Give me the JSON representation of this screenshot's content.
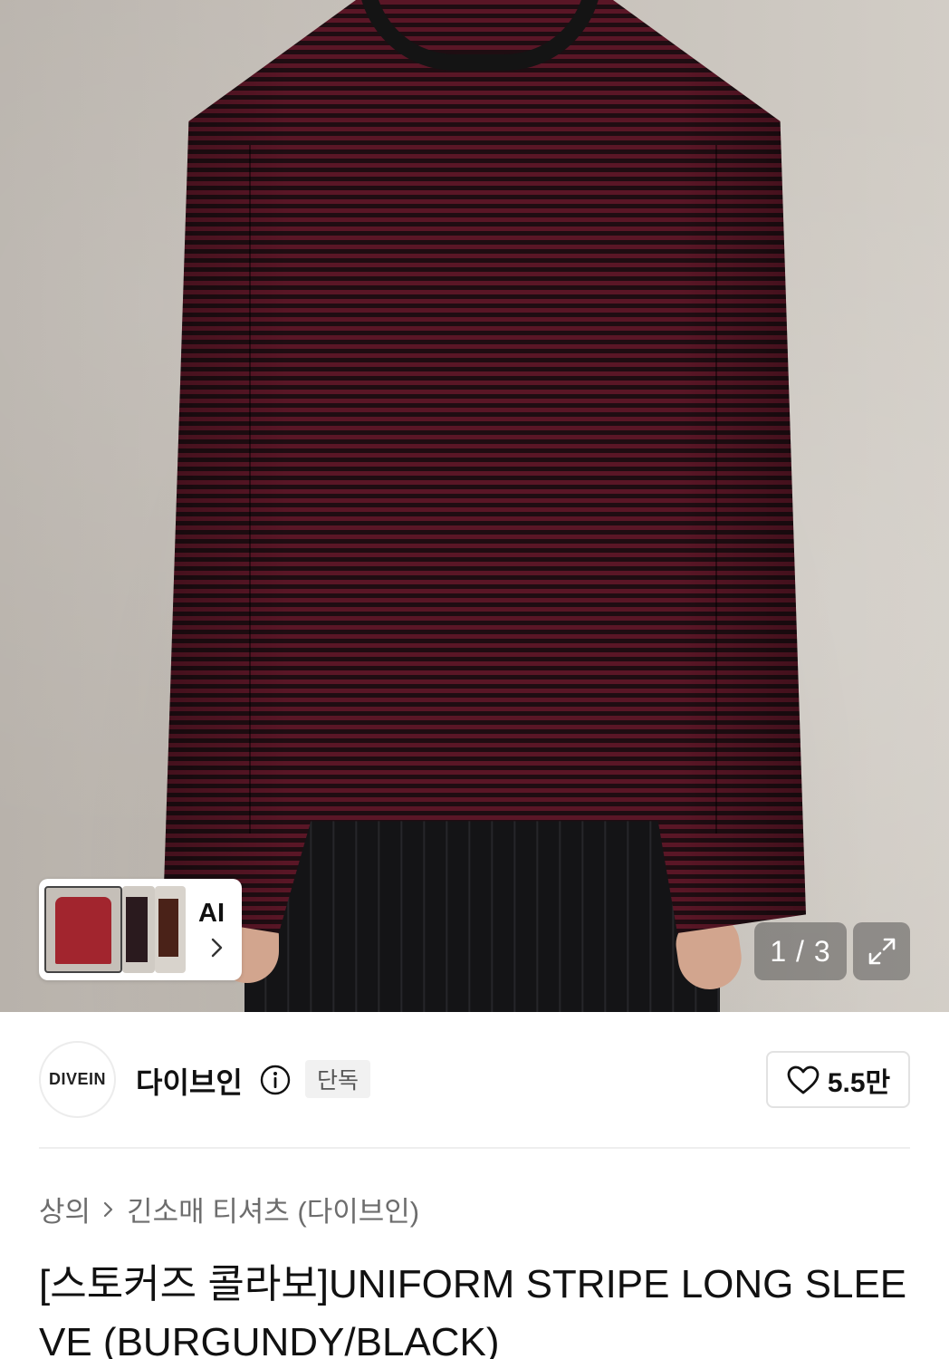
{
  "gallery": {
    "ai_label": "AI",
    "counter": "1 / 3"
  },
  "brand": {
    "logo_text": "DIVEIN",
    "name": "다이브인",
    "badge": "단독",
    "likes": "5.5만"
  },
  "breadcrumb": {
    "category": "상의",
    "subcategory": "긴소매 티셔츠 (다이브인)"
  },
  "product": {
    "title": "[스토커즈 콜라보]UNIFORM STRIPE LONG SLEEVE (BURGUNDY/BLACK)"
  },
  "icons": {
    "info": "info-icon",
    "heart": "heart-icon",
    "expand": "expand-icon",
    "chevron": "chevron-right-icon"
  },
  "colors": {
    "product_color": "#5a1626",
    "badge_bg": "#f1f1f1"
  }
}
